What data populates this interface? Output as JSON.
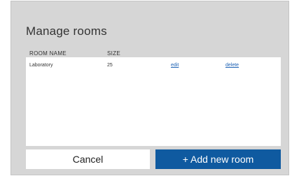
{
  "dialog": {
    "title": "Manage rooms",
    "columns": {
      "name": "ROOM NAME",
      "size": "SIZE"
    },
    "rooms": [
      {
        "name": "Laboratory",
        "size": "25",
        "edit_label": "edit",
        "delete_label": "delete"
      }
    ],
    "buttons": {
      "cancel": "Cancel",
      "add": "+ Add new room"
    }
  },
  "colors": {
    "modal_background": "#d6d6d6",
    "link": "#1f63b5",
    "primary_button": "#0f5aa0"
  }
}
